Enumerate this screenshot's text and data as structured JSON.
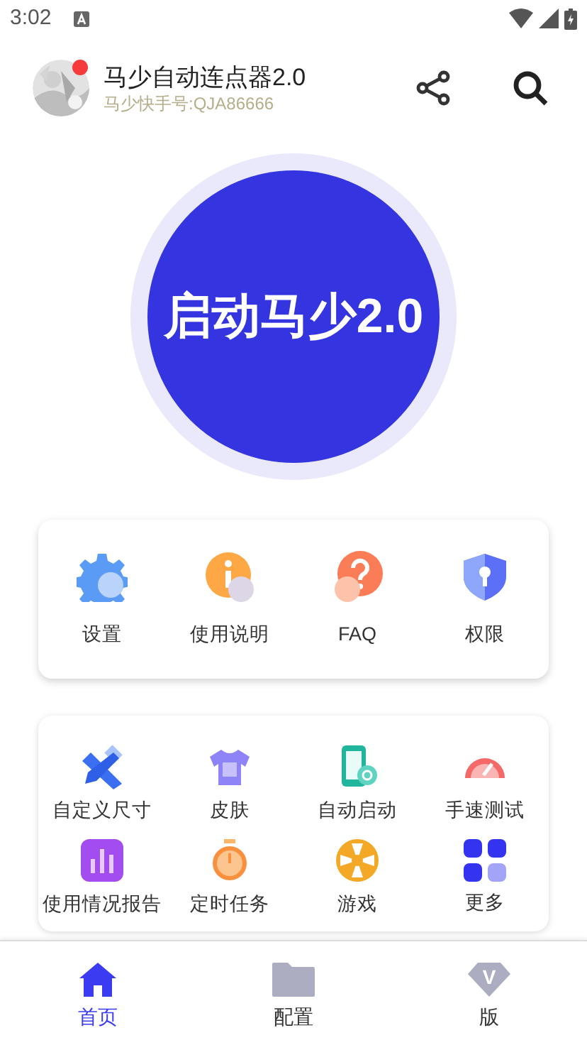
{
  "status_bar": {
    "time": "3:02"
  },
  "header": {
    "title": "马少自动连点器2.0",
    "subtitle": "马少快手号:QJA86666",
    "has_notification": true
  },
  "start_button": {
    "label": "启动马少2.0"
  },
  "quick_actions": [
    {
      "kind": "gear",
      "label": "设置"
    },
    {
      "kind": "info",
      "label": "使用说明"
    },
    {
      "kind": "question",
      "label": "FAQ"
    },
    {
      "kind": "shield",
      "label": "权限"
    }
  ],
  "tools": [
    {
      "kind": "ruler",
      "label": "自定义尺寸"
    },
    {
      "kind": "shirt",
      "label": "皮肤"
    },
    {
      "kind": "phone",
      "label": "自动启动"
    },
    {
      "kind": "gauge",
      "label": "手速测试"
    },
    {
      "kind": "chart",
      "label": "使用情况报告"
    },
    {
      "kind": "timer",
      "label": "定时任务"
    },
    {
      "kind": "wheel",
      "label": "游戏"
    },
    {
      "kind": "grid",
      "label": "更多"
    }
  ],
  "bottom_nav": [
    {
      "kind": "home",
      "label": "首页",
      "selected": true
    },
    {
      "kind": "folder",
      "label": "配置",
      "selected": false
    },
    {
      "kind": "diamond",
      "label": "版",
      "selected": false,
      "badge_letter": "V"
    }
  ]
}
